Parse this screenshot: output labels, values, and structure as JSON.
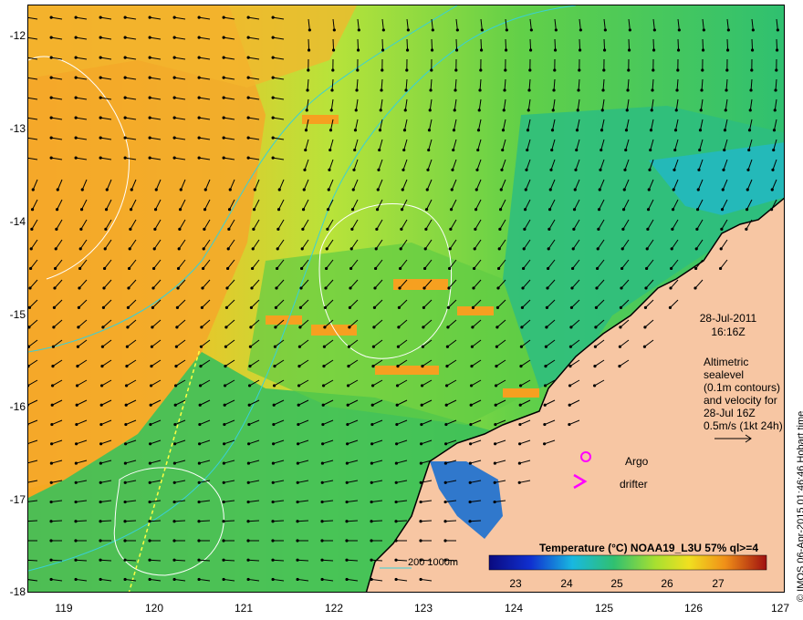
{
  "map": {
    "y_ticks": [
      "-12",
      "-13",
      "-14",
      "-15",
      "-16",
      "-17",
      "-18"
    ],
    "x_ticks": [
      "119",
      "120",
      "121",
      "122",
      "123",
      "124",
      "125",
      "126",
      "127"
    ],
    "date": "28-Jul-2011",
    "time": "16:16Z",
    "altimetry_note": [
      "Altimetric sealevel",
      "(0.1m contours)",
      "and velocity for",
      "28-Jul 16Z",
      "0.5m/s (1kt 24h)"
    ],
    "argo_label": "Argo",
    "drifter_label": "drifter",
    "bathymetry_scale_label": "200  1000m",
    "colorbar": {
      "title": "Temperature (°C) NOAA19_L3U 57% ql>=4",
      "ticks": [
        "23",
        "24",
        "25",
        "26",
        "27"
      ]
    },
    "credit": "© IMOS 06-Apr-2015 01:46:46 Hobart time",
    "colors": {
      "land": "#f7c6a3",
      "warm": "#f7a420",
      "mid": "#8fd93a",
      "cool": "#2bbd5a",
      "cold": "#1a7fd0",
      "contour_sealevel": "#ffffff",
      "bathymetry": "#38d0d8",
      "argo_drifter": "#ff00ff",
      "track": "#ffff44"
    }
  }
}
